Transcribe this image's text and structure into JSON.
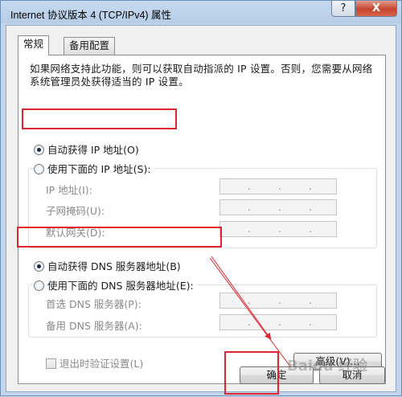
{
  "window": {
    "title": "Internet 协议版本 4 (TCP/IPv4) 属性",
    "help_label": "?",
    "close_label": "X"
  },
  "tabs": [
    {
      "label": "常规",
      "active": true
    },
    {
      "label": "备用配置",
      "active": false
    }
  ],
  "description": "如果网络支持此功能，则可以获取自动指派的 IP 设置。否则，您需要从网络系统管理员处获得适当的 IP 设置。",
  "ip": {
    "auto_label": "自动获得 IP 地址(O)",
    "manual_label": "使用下面的 IP 地址(S):",
    "auto_selected": true,
    "fields": [
      {
        "label": "IP 地址(I):",
        "value": ". . ."
      },
      {
        "label": "子网掩码(U):",
        "value": ". . ."
      },
      {
        "label": "默认网关(D):",
        "value": ". . ."
      }
    ]
  },
  "dns": {
    "auto_label": "自动获得 DNS 服务器地址(B)",
    "manual_label": "使用下面的 DNS 服务器地址(E):",
    "auto_selected": true,
    "fields": [
      {
        "label": "首选 DNS 服务器(P):",
        "value": ". . ."
      },
      {
        "label": "备用 DNS 服务器(A):",
        "value": ". . ."
      }
    ]
  },
  "validate_label": "退出时验证设置(L)",
  "advanced_label": "高级(V)...",
  "ok_label": "确定",
  "cancel_label": "取消",
  "watermark": "Baidu 经验",
  "annotation_color": "#e0232d"
}
